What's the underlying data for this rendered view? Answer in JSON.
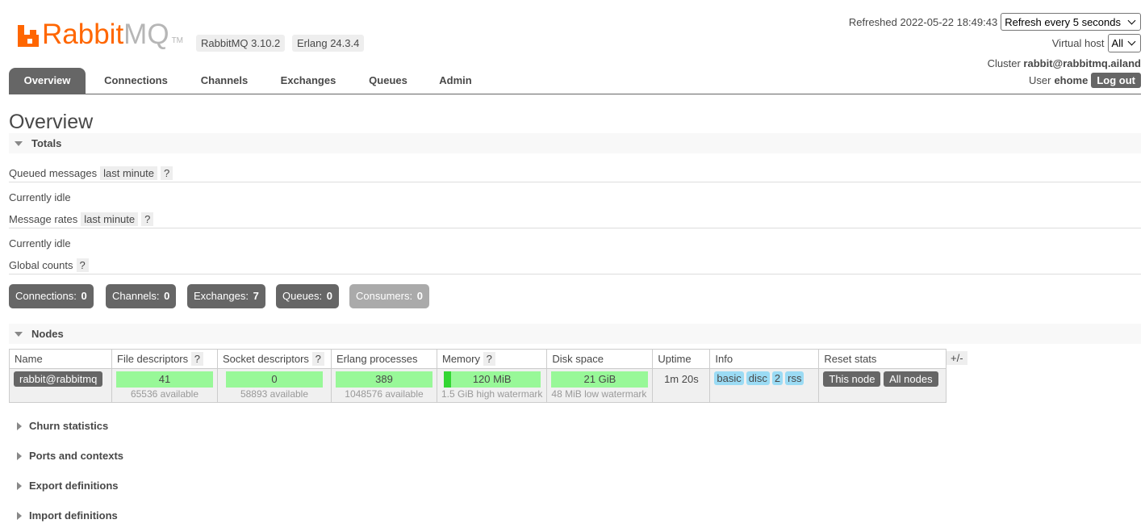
{
  "header": {
    "brand_orange": "Rabbit",
    "brand_grey": "MQ",
    "brand_tm": "TM",
    "rabbitmq_version": "RabbitMQ 3.10.2",
    "erlang_version": "Erlang 24.3.4",
    "refreshed_label": "Refreshed 2022-05-22 18:49:43",
    "refresh_select": "Refresh every 5 seconds",
    "vhost_label": "Virtual host",
    "vhost_select": "All",
    "cluster_label": "Cluster",
    "cluster_value": "rabbit@rabbitmq.ailand",
    "user_label": "User",
    "user_value": "ehome",
    "logout": "Log out"
  },
  "tabs": [
    {
      "label": "Overview",
      "active": true
    },
    {
      "label": "Connections"
    },
    {
      "label": "Channels"
    },
    {
      "label": "Exchanges"
    },
    {
      "label": "Queues"
    },
    {
      "label": "Admin"
    }
  ],
  "page_title": "Overview",
  "totals": {
    "title": "Totals",
    "queued_label": "Queued messages",
    "queued_range": "last minute",
    "queued_help": "?",
    "queued_status": "Currently idle",
    "rates_label": "Message rates",
    "rates_range": "last minute",
    "rates_help": "?",
    "rates_status": "Currently idle",
    "global_label": "Global counts",
    "global_help": "?",
    "counts": [
      {
        "label": "Connections:",
        "value": "0"
      },
      {
        "label": "Channels:",
        "value": "0"
      },
      {
        "label": "Exchanges:",
        "value": "7"
      },
      {
        "label": "Queues:",
        "value": "0"
      },
      {
        "label": "Consumers:",
        "value": "0"
      }
    ]
  },
  "nodes": {
    "title": "Nodes",
    "columns": {
      "name": "Name",
      "fd": "File descriptors",
      "sd": "Socket descriptors",
      "ep": "Erlang processes",
      "mem": "Memory",
      "disk": "Disk space",
      "uptime": "Uptime",
      "info": "Info",
      "reset": "Reset stats",
      "help": "?"
    },
    "plusminus": "+/-",
    "row": {
      "name": "rabbit@rabbitmq",
      "fd_value": "41",
      "fd_sub": "65536 available",
      "sd_value": "0",
      "sd_sub": "58893 available",
      "ep_value": "389",
      "ep_sub": "1048576 available",
      "mem_value": "120 MiB",
      "mem_sub": "1.5 GiB high watermark",
      "disk_value": "21 GiB",
      "disk_sub": "48 MiB low watermark",
      "uptime": "1m 20s",
      "info_tags": [
        "basic",
        "disc",
        "2",
        "rss"
      ],
      "reset_this": "This node",
      "reset_all": "All nodes"
    }
  },
  "collapsed_sections": [
    "Churn statistics",
    "Ports and contexts",
    "Export definitions",
    "Import definitions"
  ],
  "colors": {
    "brand": "#ff6600",
    "tab_active": "#666666",
    "bar_ok": "#98f898",
    "info_tag": "#9bdbf4"
  }
}
